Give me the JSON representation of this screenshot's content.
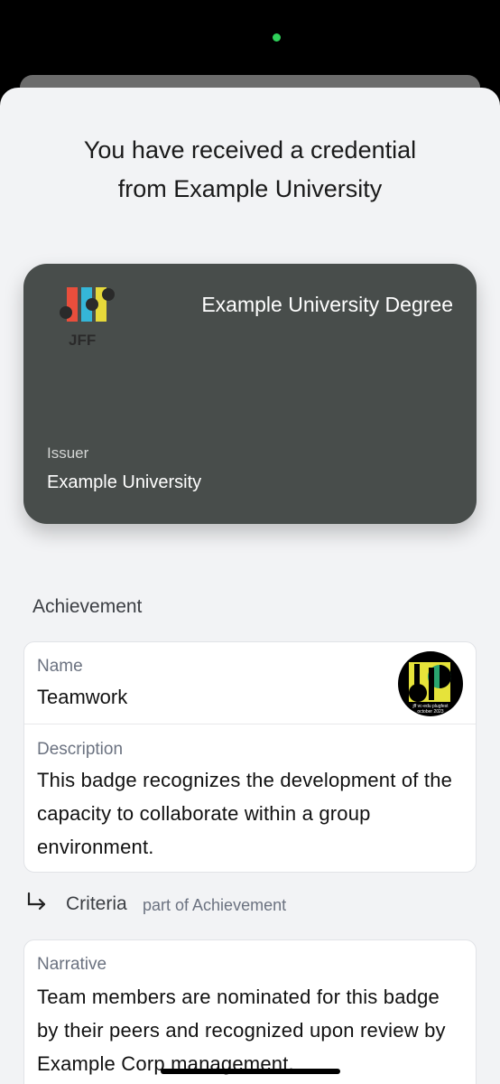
{
  "sheet": {
    "title_line1": "You have received a credential",
    "title_line2": "from Example University"
  },
  "credential": {
    "logo_text": "JFF",
    "title": "Example University Degree",
    "issuer_label": "Issuer",
    "issuer_value": "Example University",
    "card_color": "#484d4b"
  },
  "achievement": {
    "heading": "Achievement",
    "name_label": "Name",
    "name_value": "Teamwork",
    "badge_text_line1": "jff vc-edu plugfest",
    "badge_text_line2": "october 2023",
    "description_label": "Description",
    "description_value": "This badge recognizes the development of the capacity to collaborate within a group environment."
  },
  "criteria": {
    "label": "Criteria",
    "sublabel": "part of Achievement",
    "narrative_label": "Narrative",
    "narrative_value": "Team members are nominated for this badge by their peers and recognized upon review by Example Corp management."
  },
  "icons": {
    "camera": "camera-indicator-dot",
    "criteria_arrow": "return-arrow-icon"
  },
  "colors": {
    "sheet_bg": "#f2f3f5",
    "accent_green": "#2fd15a",
    "label_gray": "#6b7280"
  }
}
